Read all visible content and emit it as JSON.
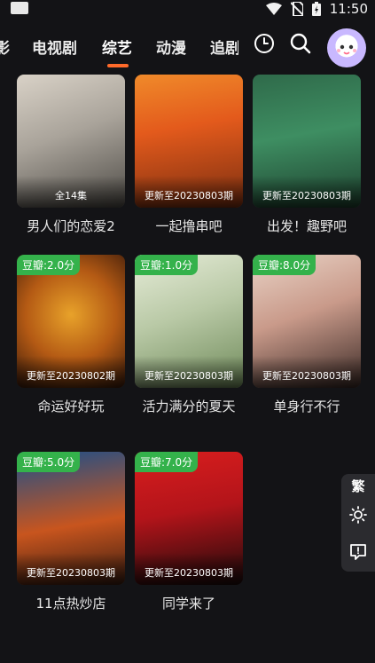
{
  "status_bar": {
    "time": "11:50"
  },
  "tabs": [
    {
      "label": "影"
    },
    {
      "label": "电视剧"
    },
    {
      "label": "综艺"
    },
    {
      "label": "动漫"
    },
    {
      "label": "追剧"
    }
  ],
  "cards": [
    {
      "title": "男人们的恋爱2",
      "update": "全14集",
      "badge": ""
    },
    {
      "title": "一起撸串吧",
      "update": "更新至20230803期",
      "badge": ""
    },
    {
      "title": "出发！趣野吧",
      "update": "更新至20230803期",
      "badge": ""
    },
    {
      "title": "命运好好玩",
      "update": "更新至20230802期",
      "badge": "豆瓣:2.0分"
    },
    {
      "title": "活力满分的夏天",
      "update": "更新至20230803期",
      "badge": "豆瓣:1.0分"
    },
    {
      "title": "单身行不行",
      "update": "更新至20230803期",
      "badge": "豆瓣:8.0分"
    },
    {
      "title": "11点热炒店",
      "update": "更新至20230803期",
      "badge": "豆瓣:5.0分"
    },
    {
      "title": "同学来了",
      "update": "更新至20230803期",
      "badge": "豆瓣:7.0分"
    }
  ],
  "side_panel": {
    "traditional_label": "繁"
  },
  "colors": {
    "accent": "#ff6a2a",
    "badge_green": "#34b24b",
    "background": "#131316"
  }
}
